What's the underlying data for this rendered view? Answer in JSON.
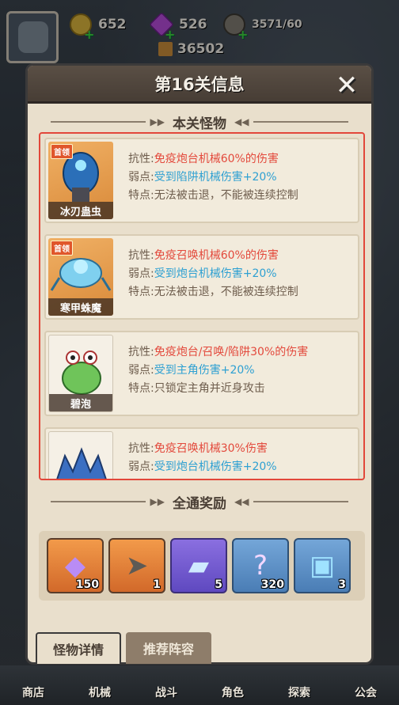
{
  "topbar": {
    "coins": "652",
    "gems": "526",
    "energy": "3571/60",
    "power": "36502"
  },
  "dialog": {
    "title": "第16关信息",
    "section_monsters": "本关怪物",
    "section_rewards": "全通奖励"
  },
  "labels": {
    "resist": "抗性:",
    "weak": "弱点:",
    "trait": "特点:"
  },
  "monsters": [
    {
      "name": "冰刃蛊虫",
      "boss_badge": "首领",
      "resist": "免疫炮台机械60%的伤害",
      "weak": "受到陷阱机械伤害+20%",
      "trait": "无法被击退，不能被连续控制"
    },
    {
      "name": "寒甲蛛魔",
      "boss_badge": "首领",
      "resist": "免疫召唤机械60%的伤害",
      "weak": "受到炮台机械伤害+20%",
      "trait": "无法被击退，不能被连续控制"
    },
    {
      "name": "碧泡",
      "resist": "免疫炮台/召唤/陷阱30%的伤害",
      "weak": "受到主角伤害+20%",
      "trait": "只锁定主角并近身攻击"
    },
    {
      "name": "",
      "resist": "免疫召唤机械30%伤害",
      "weak": "受到炮台机械伤害+20%"
    }
  ],
  "rewards": [
    {
      "icon": "gem-icon",
      "count": "150"
    },
    {
      "icon": "shark-weapon-icon",
      "count": "1"
    },
    {
      "icon": "ticket-icon",
      "count": "5"
    },
    {
      "icon": "mystery-orb-icon",
      "count": "320"
    },
    {
      "icon": "crystal-chest-icon",
      "count": "3"
    }
  ],
  "tabs": {
    "monster_details": "怪物详情",
    "recommended_lineup": "推荐阵容"
  },
  "nav": [
    "商店",
    "机械",
    "战斗",
    "角色",
    "探索",
    "公会"
  ],
  "colors": {
    "highlight_border": "#e2473a",
    "resist": "#e3493c",
    "weak": "#2ea0d2"
  }
}
